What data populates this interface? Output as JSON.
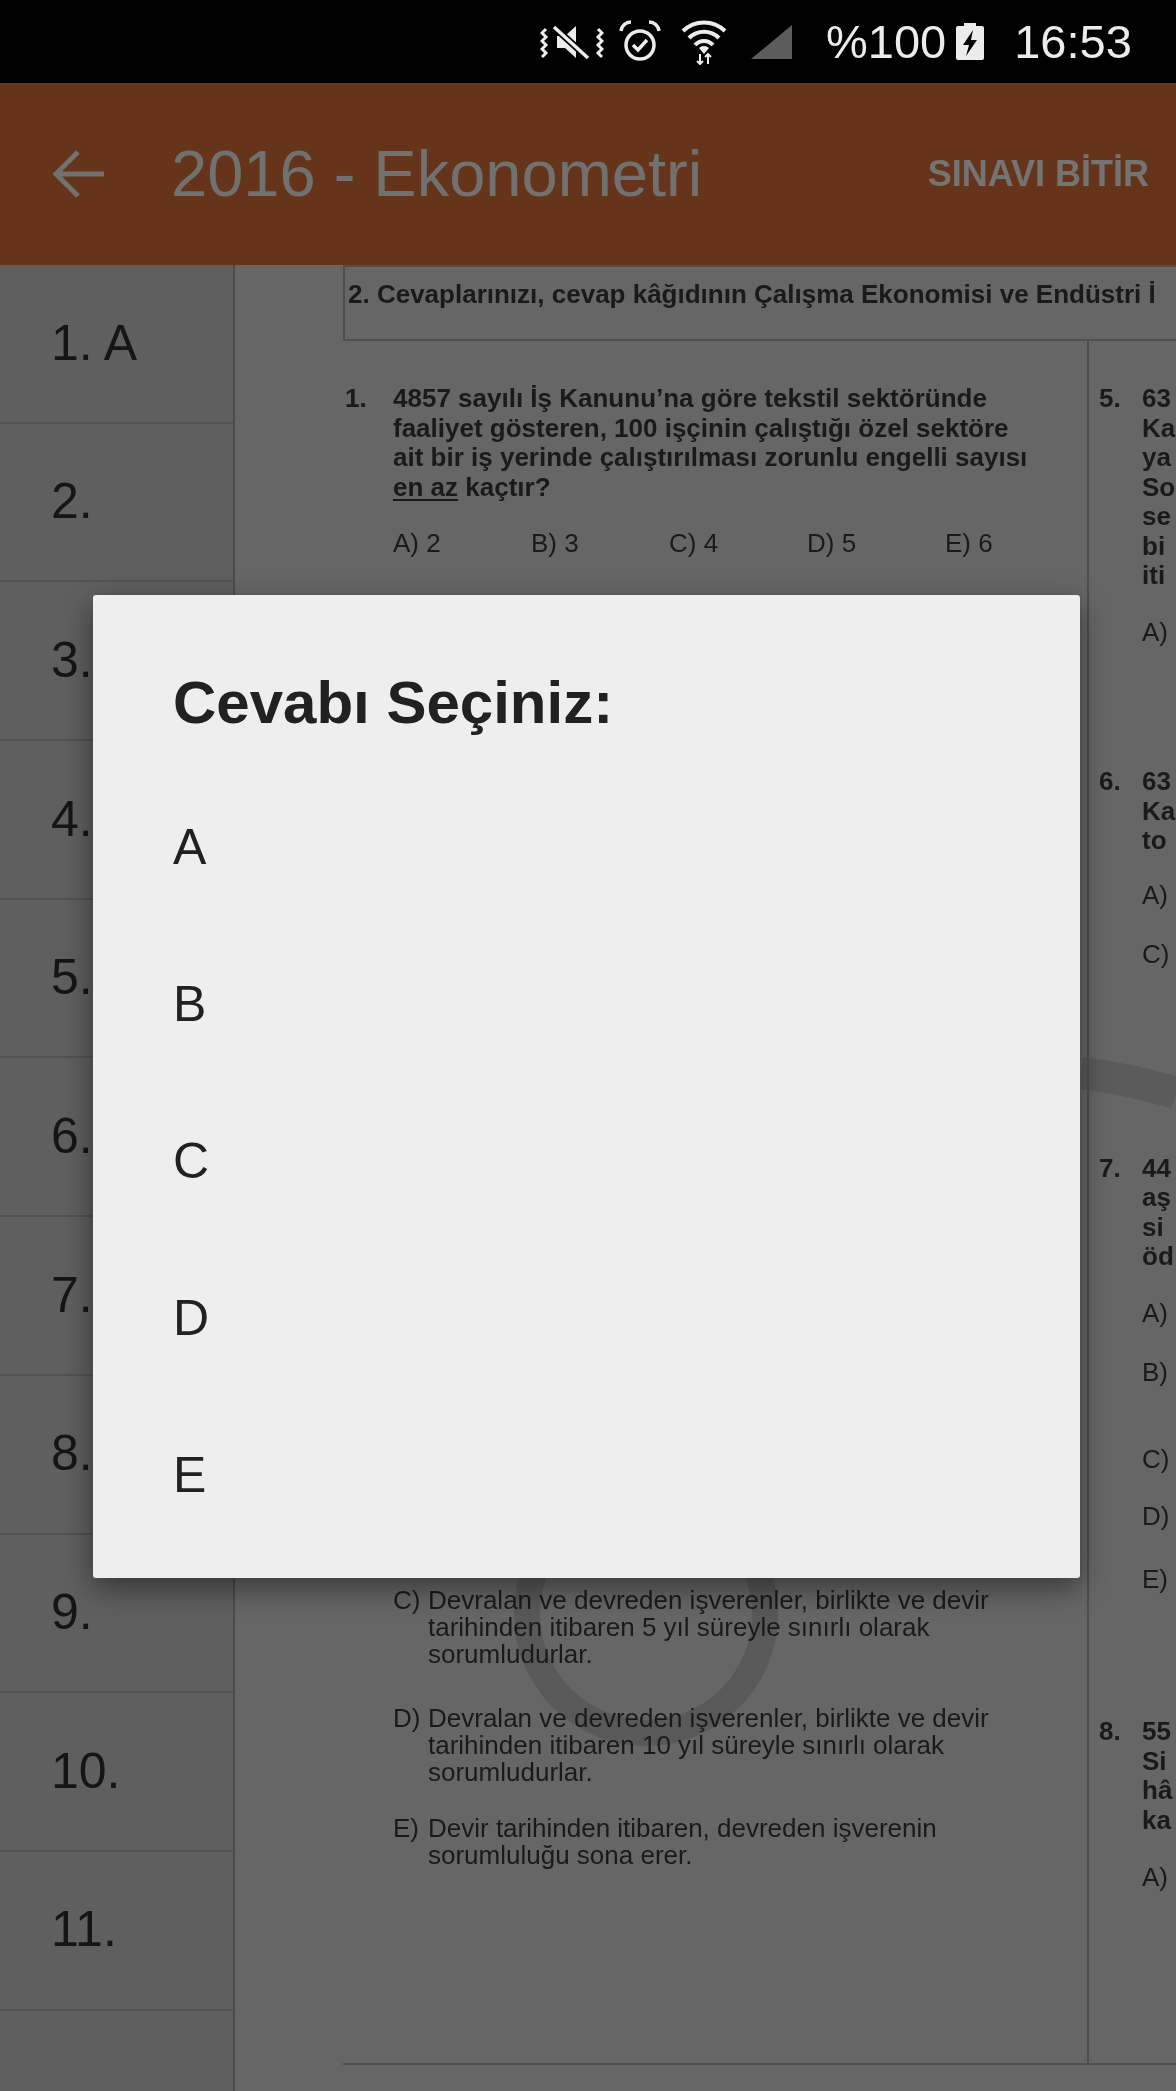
{
  "status_bar": {
    "battery": "%100",
    "time": "16:53"
  },
  "app_bar": {
    "title": "2016 - Ekonometri",
    "action": "SINAVI BİTİR"
  },
  "sidebar": {
    "items": [
      {
        "label": "1. A"
      },
      {
        "label": "2."
      },
      {
        "label": "3."
      },
      {
        "label": "4."
      },
      {
        "label": "5."
      },
      {
        "label": "6."
      },
      {
        "label": "7."
      },
      {
        "label": "8."
      },
      {
        "label": "9."
      },
      {
        "label": "10."
      },
      {
        "label": "11."
      }
    ]
  },
  "document": {
    "header": "2. Cevaplarınızı, cevap kâğıdının Çalışma Ekonomisi ve Endüstri İ",
    "left_column": {
      "questions": [
        {
          "number": "1.",
          "lines": [
            [
              {
                "text": "4857 sayılı İş Kanunu’na göre tekstil sektöründe",
                "underlined": false
              }
            ],
            [
              {
                "text": "faaliyet gösteren, 100 işçinin çalıştığı özel sektöre",
                "underlined": false
              }
            ],
            [
              {
                "text": "ait bir iş yerinde çalıştırılması zorunlu engelli sayısı",
                "underlined": false
              }
            ],
            [
              {
                "text": "en az",
                "underlined": true
              },
              {
                "text": "kaçtır?",
                "underlined": false
              }
            ]
          ],
          "choices": [
            "A) 2",
            "B) 3",
            "C) 4",
            "D) 5",
            "E) 6"
          ]
        }
      ],
      "trailing_options": [
        {
          "letter": "C)",
          "lines": [
            "Devralan ve devreden işverenler, birlikte ve devir",
            "tarihinden itibaren 5 yıl süreyle sınırlı olarak",
            "sorumludurlar."
          ]
        },
        {
          "letter": "D)",
          "lines": [
            "Devralan ve devreden işverenler, birlikte ve devir",
            "tarihinden itibaren 10 yıl süreyle sınırlı olarak",
            "sorumludurlar."
          ]
        },
        {
          "letter": "E)",
          "lines": [
            "Devir tarihinden itibaren, devreden işverenin",
            "sorumluluğu sona erer."
          ]
        }
      ]
    },
    "right_column": {
      "questions": [
        {
          "number": "5.",
          "lines": [
            "63",
            "Ka",
            "ya",
            "So",
            "se",
            "bi",
            "iti"
          ],
          "choices": [
            "A)"
          ]
        },
        {
          "number": "6.",
          "lines": [
            "63",
            "Ka",
            "to"
          ],
          "choices": [
            "A)",
            "C)"
          ]
        },
        {
          "number": "7.",
          "lines": [
            "44",
            "aş",
            "si",
            "öd"
          ],
          "choices": [
            "A)",
            "B)",
            "C)",
            "D)",
            "E)"
          ]
        },
        {
          "number": "8.",
          "lines": [
            "55",
            "Si",
            "hâ",
            "ka"
          ],
          "choices": [
            "A)"
          ]
        }
      ]
    }
  },
  "dialog": {
    "title": "Cevabı Seçiniz:",
    "options": [
      {
        "label": "A"
      },
      {
        "label": "B"
      },
      {
        "label": "C"
      },
      {
        "label": "D"
      },
      {
        "label": "E"
      }
    ]
  }
}
